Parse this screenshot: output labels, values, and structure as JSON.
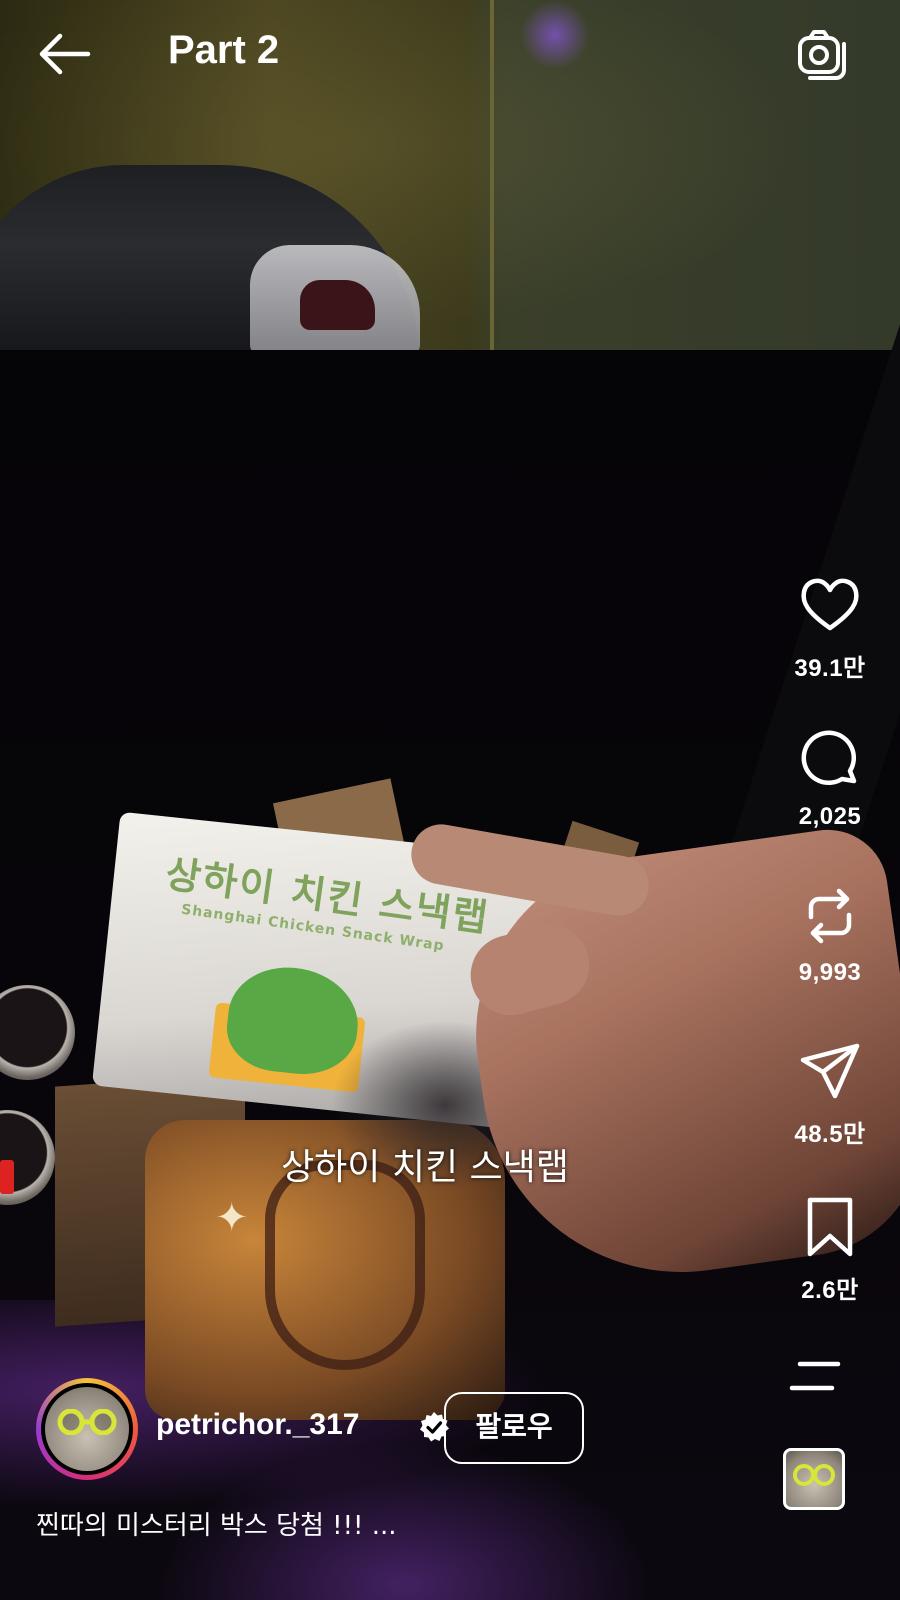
{
  "header": {
    "title": "Part 2"
  },
  "actions": {
    "likes": "39.1만",
    "comments": "2,025",
    "reposts": "9,993",
    "shares": "48.5만",
    "saves": "2.6만"
  },
  "video": {
    "wrap_title": "상하이 치킨 스낵랩",
    "wrap_subtitle": "Shanghai Chicken Snack Wrap",
    "subtitle_overlay": "상하이 치킨 스낵랩"
  },
  "author": {
    "username": "petrichor._317",
    "verified": true,
    "follow_label": "팔로우"
  },
  "caption": "찐따의 미스터리 박스 당첨 !!! ...",
  "colors": {
    "text": "#ffffff",
    "background": "#000000",
    "story_ring": [
      "#f4c23a",
      "#ee5a3b",
      "#d62e7a",
      "#9a3bd1"
    ],
    "wrap_green": "#7fa35c"
  },
  "icons": {
    "back": "arrow-left-icon",
    "camera": "camera-icon",
    "like": "heart-icon",
    "comment": "comment-bubble-icon",
    "repost": "repost-arrows-icon",
    "share": "paper-plane-icon",
    "save": "bookmark-icon",
    "more": "menu-lines-icon",
    "verified": "verified-badge-icon"
  }
}
